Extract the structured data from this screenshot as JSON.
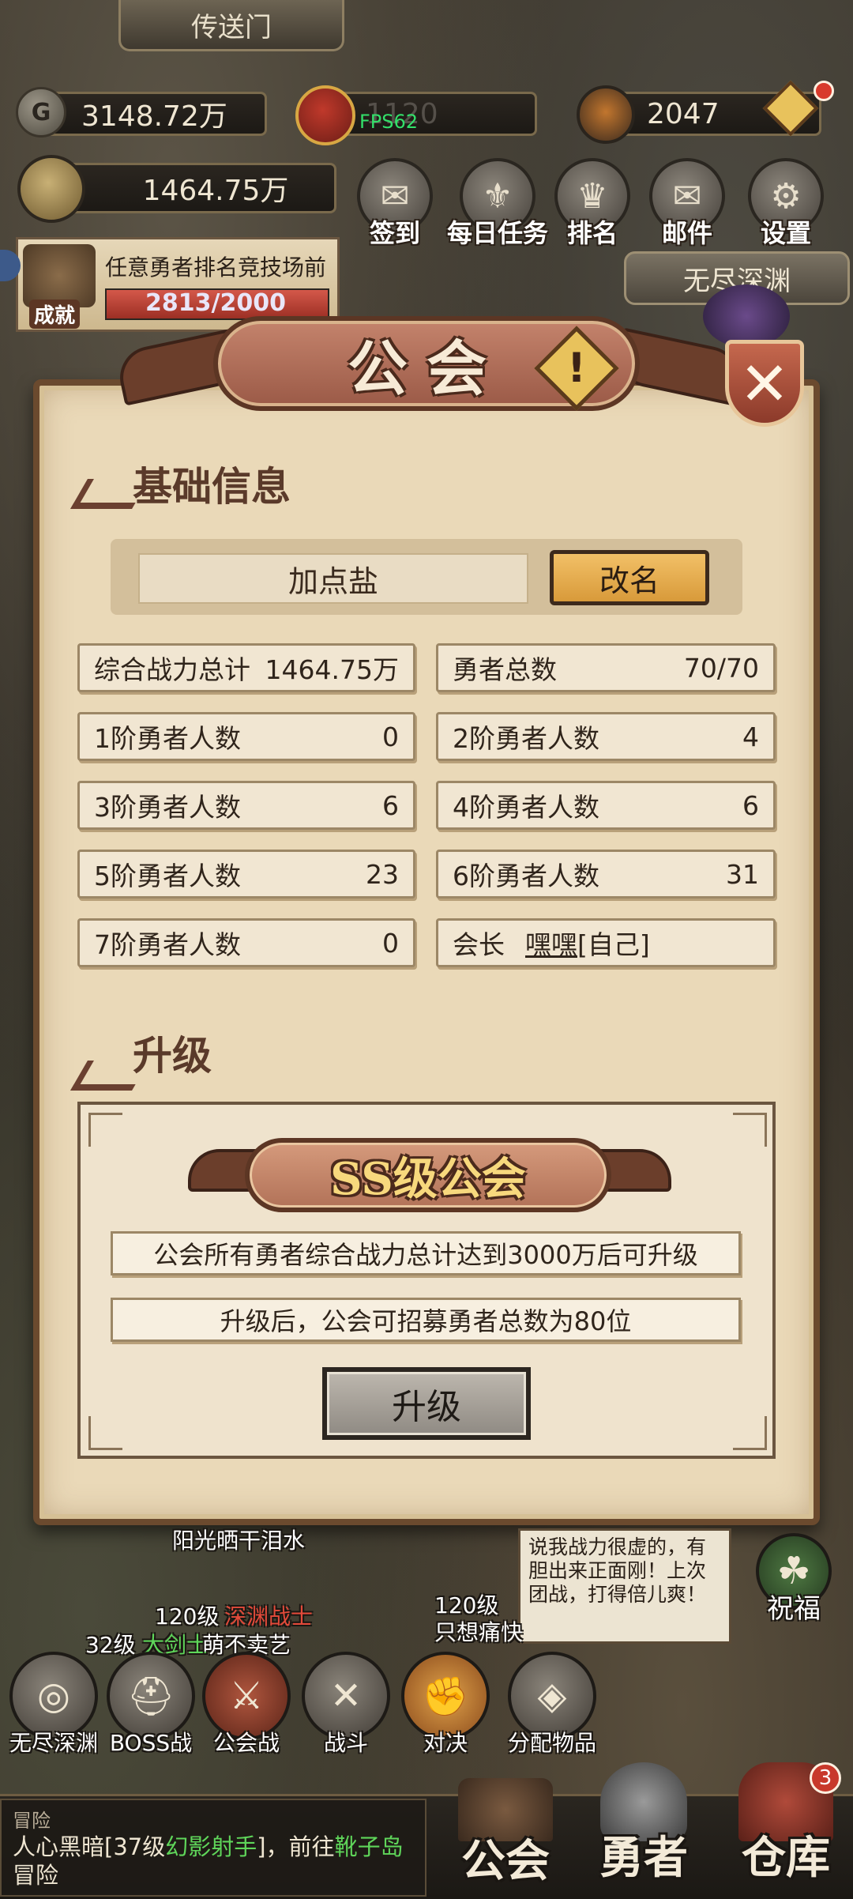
{
  "top": {
    "portal_label": "传送门",
    "gold": "3148.72万",
    "medal_value": "1120",
    "fps": "FPS62",
    "gem": "2047",
    "power": "1464.75万",
    "abyss_label": "无尽深渊"
  },
  "menu": [
    {
      "label": "签到",
      "icon": "scroll-icon"
    },
    {
      "label": "每日任务",
      "icon": "quest-icon"
    },
    {
      "label": "排名",
      "icon": "trophy-icon"
    },
    {
      "label": "邮件",
      "icon": "mail-icon"
    },
    {
      "label": "设置",
      "icon": "gear-icon"
    }
  ],
  "achievement": {
    "badge": "成就",
    "task": "任意勇者排名竞技场前",
    "progress": "2813/2000"
  },
  "panel": {
    "title": "公会",
    "basic_title": "基础信息",
    "guild_name": "加点盐",
    "rename_label": "改名",
    "stats": [
      {
        "label": "综合战力总计",
        "value": "1464.75万"
      },
      {
        "label": "勇者总数",
        "value": "70/70"
      },
      {
        "label": "1阶勇者人数",
        "value": "0"
      },
      {
        "label": "2阶勇者人数",
        "value": "4"
      },
      {
        "label": "3阶勇者人数",
        "value": "6"
      },
      {
        "label": "4阶勇者人数",
        "value": "6"
      },
      {
        "label": "5阶勇者人数",
        "value": "23"
      },
      {
        "label": "6阶勇者人数",
        "value": "31"
      },
      {
        "label": "7阶勇者人数",
        "value": "0"
      }
    ],
    "leader_label": "会长",
    "leader_name": "嘿嘿",
    "leader_tag": "[自己]",
    "upgrade_title": "升级",
    "grade": "SS级公会",
    "req_line": "公会所有勇者综合战力总计达到3000万后可升级",
    "after_line": "升级后，公会可招募勇者总数为80位",
    "upgrade_button": "升级"
  },
  "world": {
    "name_sun": "阳光晒干泪水",
    "speech": "说我战力很虚的，有胆出来正面刚！上次团战，打得倍儿爽！",
    "lv_1": "120级",
    "cls_1": "深渊战士",
    "lv_2": "120级",
    "name_2": "只想痛快",
    "lv_3": "32级",
    "cls_3": "大剑士",
    "name_3": "萌不卖艺",
    "bless": "祝福"
  },
  "actions": [
    {
      "label": "无尽深渊",
      "icon": "abyss-icon"
    },
    {
      "label": "BOSS战",
      "icon": "helmet-icon"
    },
    {
      "label": "公会战",
      "icon": "shield-icon"
    },
    {
      "label": "战斗",
      "icon": "swords-icon"
    },
    {
      "label": "对决",
      "icon": "fist-icon"
    },
    {
      "label": "分配物品",
      "icon": "bag-icon"
    }
  ],
  "log": {
    "title": "冒险",
    "line_a": "人心黑暗[37级",
    "line_cls": "幻影射手",
    "line_b": "]，前往",
    "line_place": "靴子岛",
    "line_c": "冒险"
  },
  "tabs": [
    {
      "label": "公会"
    },
    {
      "label": "勇者"
    },
    {
      "label": "仓库",
      "badge": "3"
    }
  ]
}
